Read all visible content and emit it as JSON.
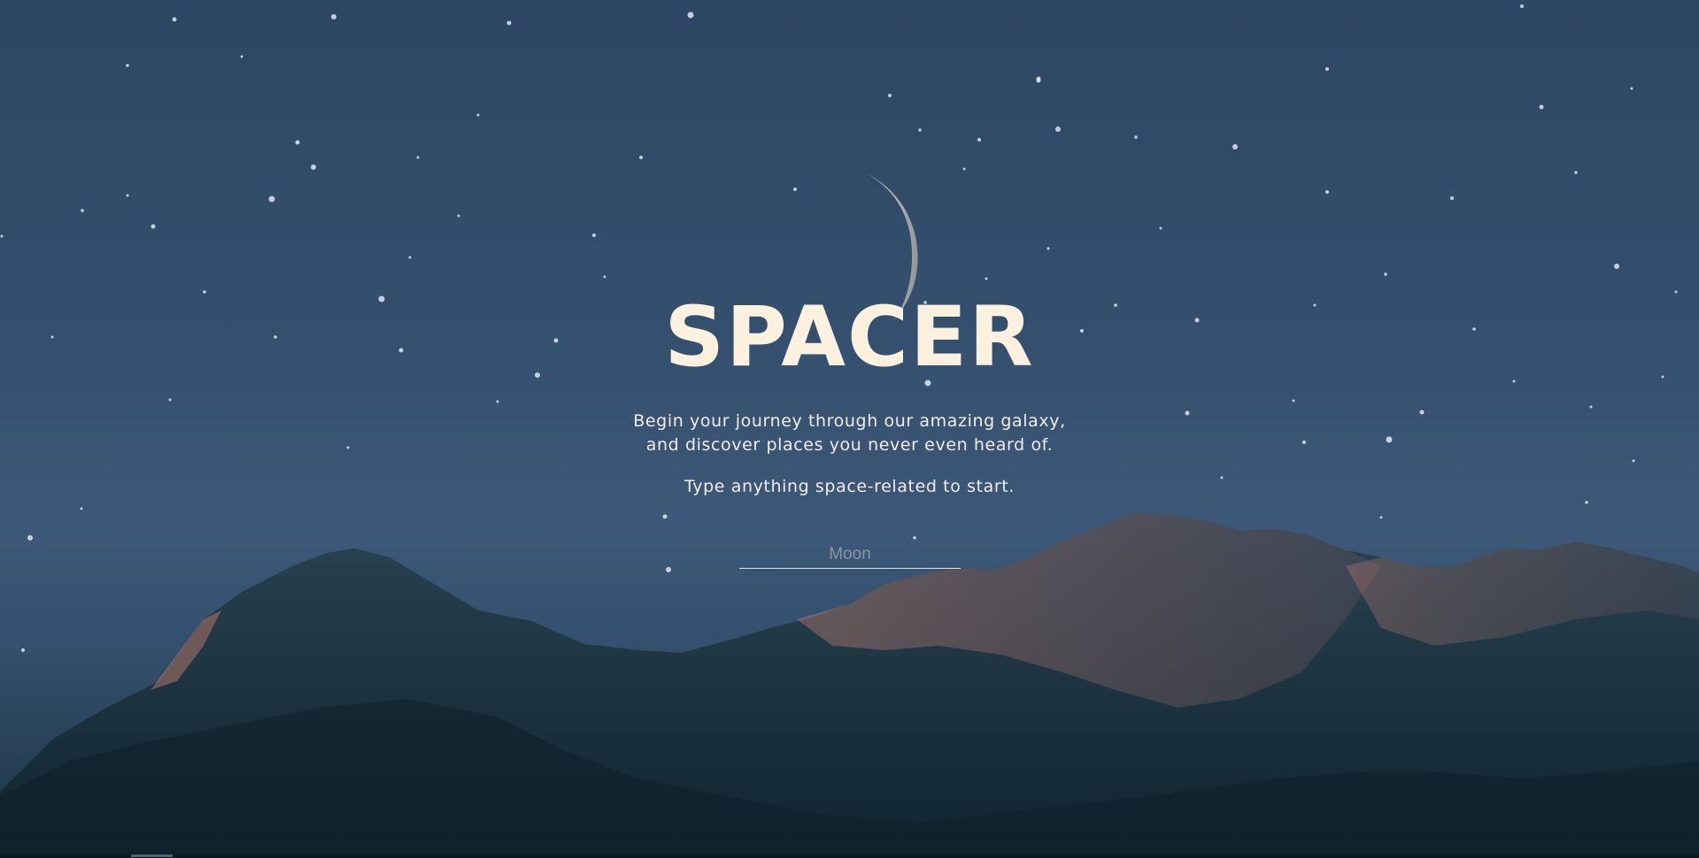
{
  "hero": {
    "title": "SPACER",
    "subtitle_line1": "Begin your journey through our amazing galaxy,",
    "subtitle_line2": "and discover places you never even heard of.",
    "prompt": "Type anything space-related to start."
  },
  "search": {
    "placeholder": "Moon",
    "value": ""
  },
  "background": {
    "sky_icon": "crescent-moon-icon",
    "scene": "starry-sky-mountains"
  },
  "colors": {
    "title": "#fbf1de",
    "text": "#f1ede6",
    "sky": "#35506f",
    "mountain_shadow": "#17303c",
    "alpenglow": "#b87572"
  }
}
